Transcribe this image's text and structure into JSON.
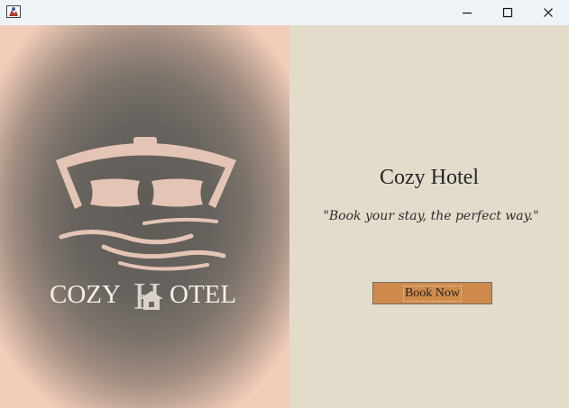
{
  "window": {
    "title": "",
    "controls": [
      "minimize-icon",
      "maximize-icon",
      "close-icon"
    ]
  },
  "logo": {
    "text_left": "COZY",
    "text_right": "OTEL",
    "text_center": "H",
    "color": "#e4c4b4"
  },
  "content": {
    "title": "Cozy Hotel",
    "tagline": "\"Book your stay, the perfect way.\"",
    "book_button_label": "Book Now"
  },
  "colors": {
    "right_panel_bg": "#e4dccb",
    "button_bg": "#cf8a4b",
    "logo_vignette_center": "#5f5c57",
    "logo_vignette_edge": "#f2cdb9"
  }
}
